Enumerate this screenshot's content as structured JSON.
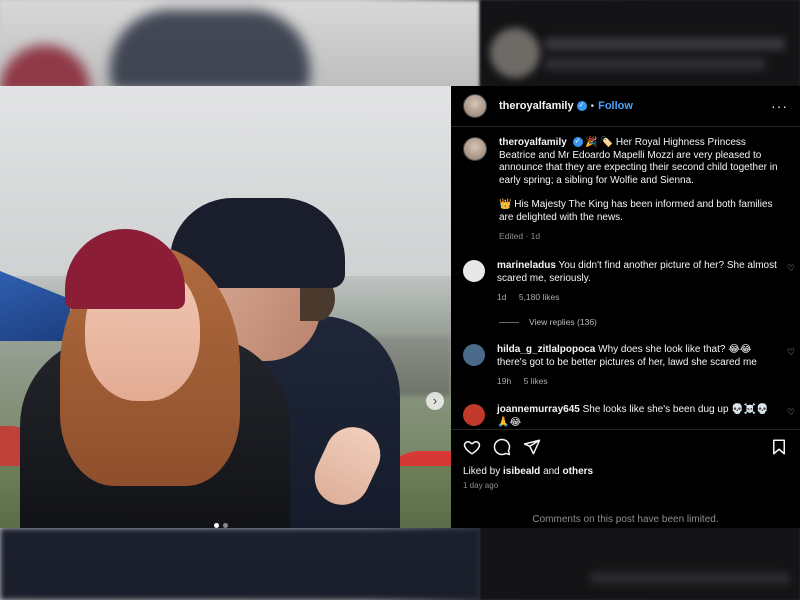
{
  "post": {
    "username": "theroyalfamily",
    "follow_label": "Follow",
    "separator": "•",
    "more_label": "···"
  },
  "caption": {
    "username": "theroyalfamily",
    "emojis": "🎉 🏷️",
    "text": "Her Royal Highness Princess Beatrice and Mr Edoardo Mapelli Mozzi are very pleased to announce that they are expecting their second child together in early spring; a sibling for Wolfie and Sienna.",
    "paragraph2": "👑 His Majesty The King has been informed and both families are delighted with the news.",
    "edited": "Edited · 1d"
  },
  "comments": [
    {
      "username": "marineladus",
      "text": "You didn't find another picture of her? She almost scared me, seriously.",
      "time": "1d",
      "likes": "5,180 likes",
      "avatar_color": "#e8e8e8"
    },
    {
      "username": "hilda_g_zitlalpopoca",
      "text": "Why does she look like that? 😂😂 there's got to be better pictures of her, lawd she scared me",
      "time": "19h",
      "likes": "5 likes",
      "avatar_color": "#4a6a8a"
    },
    {
      "username": "joannemurray645",
      "text": "She looks like she's been dug up 💀☠️💀 🙏😂",
      "avatar_color": "#c0392b"
    }
  ],
  "view_replies": "View replies (136)",
  "actions": {
    "heart_icon": "heart-icon",
    "comment_icon": "comment-icon",
    "share_icon": "share-icon",
    "bookmark_icon": "bookmark-icon"
  },
  "liked_by": {
    "prefix": "Liked by",
    "user": "isibeald",
    "and": "and",
    "others": "others"
  },
  "posted_ago": "1 day ago",
  "comments_limited": "Comments on this post have been limited.",
  "colors": {
    "accent": "#4aa3ff",
    "verified": "#3897f0",
    "panel_bg": "#000000"
  }
}
